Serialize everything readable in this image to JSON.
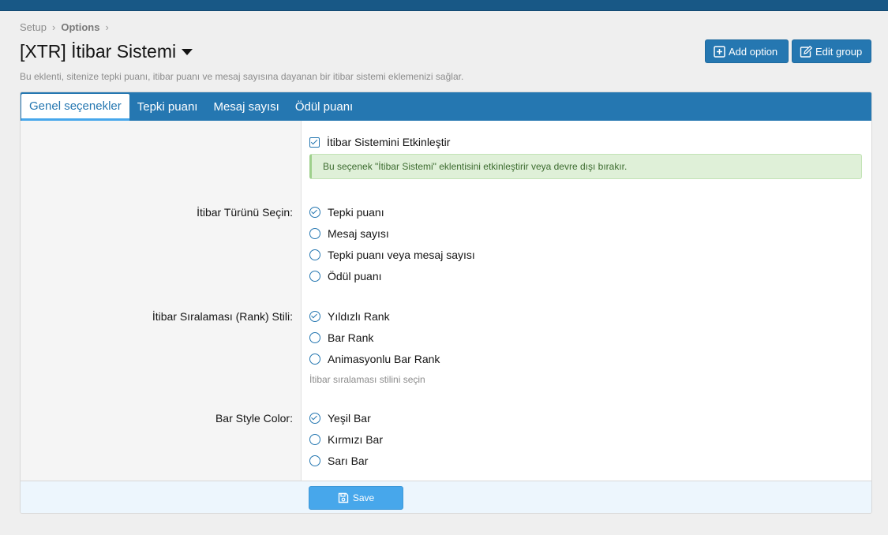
{
  "breadcrumb": {
    "items": [
      "Setup",
      "Options"
    ]
  },
  "header": {
    "title": "[XTR] İtibar Sistemi",
    "description": "Bu eklenti, sitenize tepki puanı, itibar puanı ve mesaj sayısına dayanan bir itibar sistemi eklemenizi sağlar.",
    "add_option_label": "Add option",
    "edit_group_label": "Edit group"
  },
  "tabs": [
    "Genel seçenekler",
    "Tepki puanı",
    "Mesaj sayısı",
    "Ödül puanı"
  ],
  "form": {
    "enable": {
      "label": "İtibar Sistemini Etkinleştir",
      "checked": true,
      "hint": "Bu seçenek \"İtibar Sistemi\" eklentisini etkinleştirir veya devre dışı bırakır."
    },
    "type": {
      "label": "İtibar Türünü Seçin:",
      "options": [
        "Tepki puanı",
        "Mesaj sayısı",
        "Tepki puanı veya mesaj sayısı",
        "Ödül puanı"
      ],
      "selected": "Tepki puanı"
    },
    "rank_style": {
      "label": "İtibar Sıralaması (Rank) Stili:",
      "options": [
        "Yıldızlı Rank",
        "Bar Rank",
        "Animasyonlu Bar Rank"
      ],
      "selected": "Yıldızlı Rank",
      "explain": "İtibar sıralaması stilini seçin"
    },
    "bar_color": {
      "label": "Bar Style Color:",
      "options": [
        "Yeşil Bar",
        "Kırmızı Bar",
        "Sarı Bar"
      ],
      "selected": "Yeşil Bar"
    }
  },
  "footer": {
    "save_label": "Save"
  },
  "colors": {
    "primary": "#2577b1",
    "topbar": "#185886",
    "save": "#47a7eb",
    "hint_bg": "#dff0d8"
  },
  "icons": {
    "add": "plus-square-icon",
    "edit": "edit-icon",
    "save": "save-icon",
    "dropdown": "caret-down-icon"
  }
}
